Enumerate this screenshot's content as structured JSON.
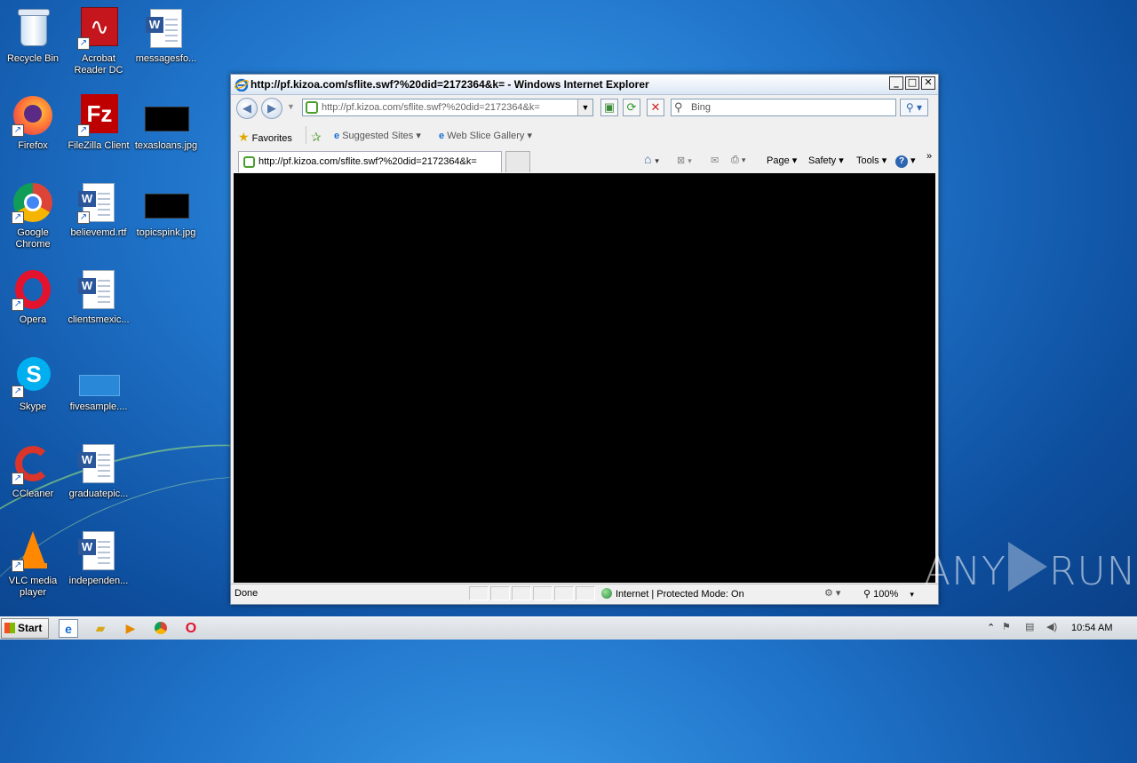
{
  "desktop": {
    "icons": [
      {
        "label": "Recycle Bin",
        "icon": "recycle-bin-icon"
      },
      {
        "label": "Acrobat Reader DC",
        "icon": "acrobat-icon"
      },
      {
        "label": "messagesfo...",
        "icon": "word-doc-icon"
      },
      {
        "label": "Firefox",
        "icon": "firefox-icon"
      },
      {
        "label": "FileZilla Client",
        "icon": "filezilla-icon"
      },
      {
        "label": "texasloans.jpg",
        "icon": "image-thumbnail-icon"
      },
      {
        "label": "Google Chrome",
        "icon": "chrome-icon"
      },
      {
        "label": "believemd.rtf",
        "icon": "word-doc-icon"
      },
      {
        "label": "topicspink.jpg",
        "icon": "image-thumbnail-icon"
      },
      {
        "label": "Opera",
        "icon": "opera-icon"
      },
      {
        "label": "clientsmexic...",
        "icon": "word-doc-icon"
      },
      {
        "label": "Skype",
        "icon": "skype-icon"
      },
      {
        "label": "fivesample....",
        "icon": "image-thumbnail-icon"
      },
      {
        "label": "CCleaner",
        "icon": "ccleaner-icon"
      },
      {
        "label": "graduatepic...",
        "icon": "word-doc-icon"
      },
      {
        "label": "VLC media player",
        "icon": "vlc-icon"
      },
      {
        "label": "independen...",
        "icon": "word-doc-icon"
      }
    ]
  },
  "ie": {
    "title": "http://pf.kizoa.com/sflite.swf?%20did=2172364&k= - Windows Internet Explorer",
    "address": "http://pf.kizoa.com/sflite.swf?%20did=2172364&k=",
    "search_placeholder": "Bing",
    "favorites_label": "Favorites",
    "suggested_sites": "Suggested Sites",
    "web_slice_gallery": "Web Slice Gallery",
    "tab_title": "http://pf.kizoa.com/sflite.swf?%20did=2172364&k=",
    "commands": {
      "page": "Page",
      "safety": "Safety",
      "tools": "Tools"
    },
    "status": {
      "text": "Done",
      "zone": "Internet | Protected Mode: On",
      "zoom": "100%"
    }
  },
  "watermark": {
    "left": "ANY",
    "right": "RUN"
  },
  "taskbar": {
    "start_label": "Start",
    "clock": "10:54 AM"
  },
  "colors": {
    "desktop_blue": "#1f73c9",
    "content_black": "#000000",
    "secure_green": "#4aa02c"
  }
}
